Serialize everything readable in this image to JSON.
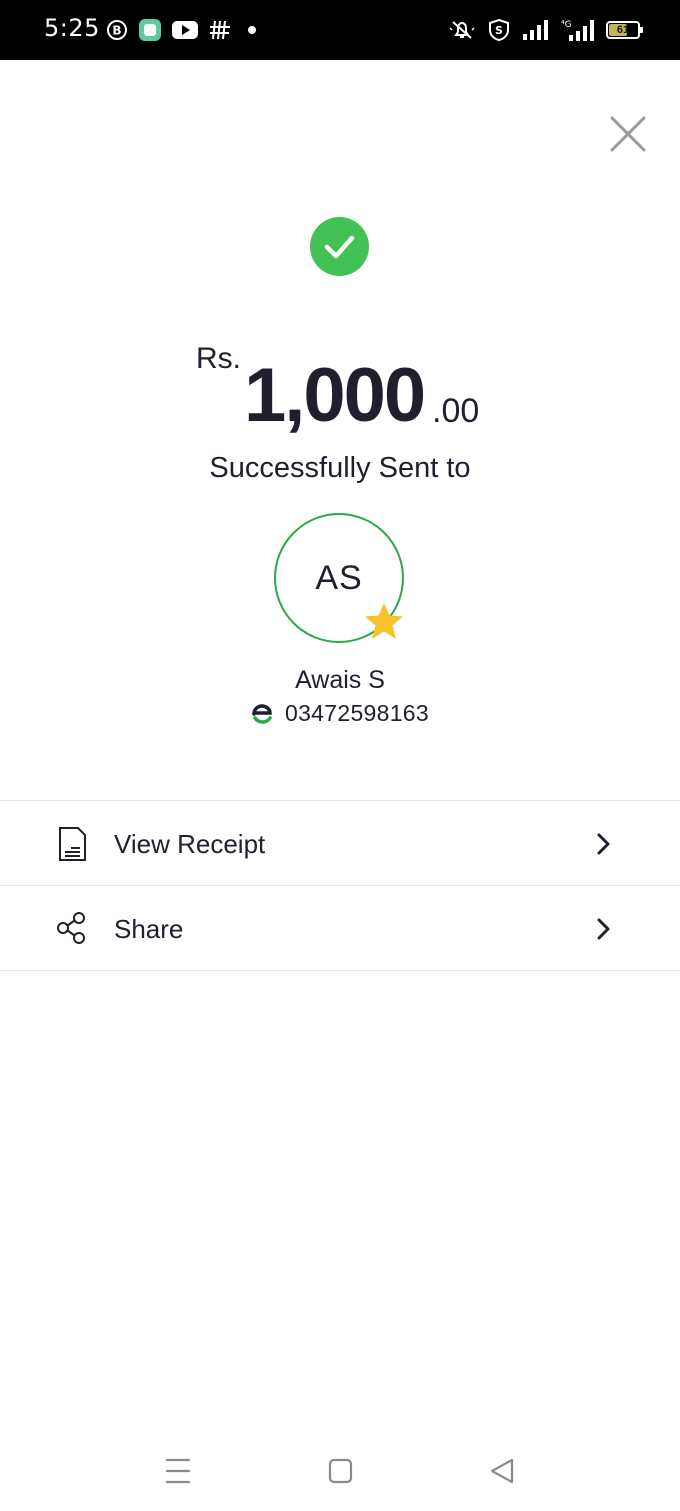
{
  "status_bar": {
    "time": "5:25",
    "battery_level": "61",
    "left_icons": [
      "b-circle-icon",
      "app-square-icon",
      "youtube-icon",
      "hashtag-icon",
      "dot-icon"
    ],
    "right_icons": [
      "mute-icon",
      "vpn-shield-icon",
      "signal-icon",
      "signal-4g-icon",
      "battery-icon"
    ]
  },
  "transaction": {
    "currency": "Rs.",
    "amount_whole": "1,000",
    "amount_decimal": ".00",
    "status_text": "Successfully Sent to"
  },
  "recipient": {
    "initials": "AS",
    "name": "Awais S",
    "phone": "03472598163",
    "is_favorite": true
  },
  "actions": [
    {
      "label": "View Receipt",
      "icon": "receipt-icon"
    },
    {
      "label": "Share",
      "icon": "share-icon"
    }
  ],
  "colors": {
    "success_green": "#42c155",
    "avatar_border": "#2aa84a",
    "star_yellow": "#f6c32f",
    "text_dark": "#1f1f2e"
  }
}
